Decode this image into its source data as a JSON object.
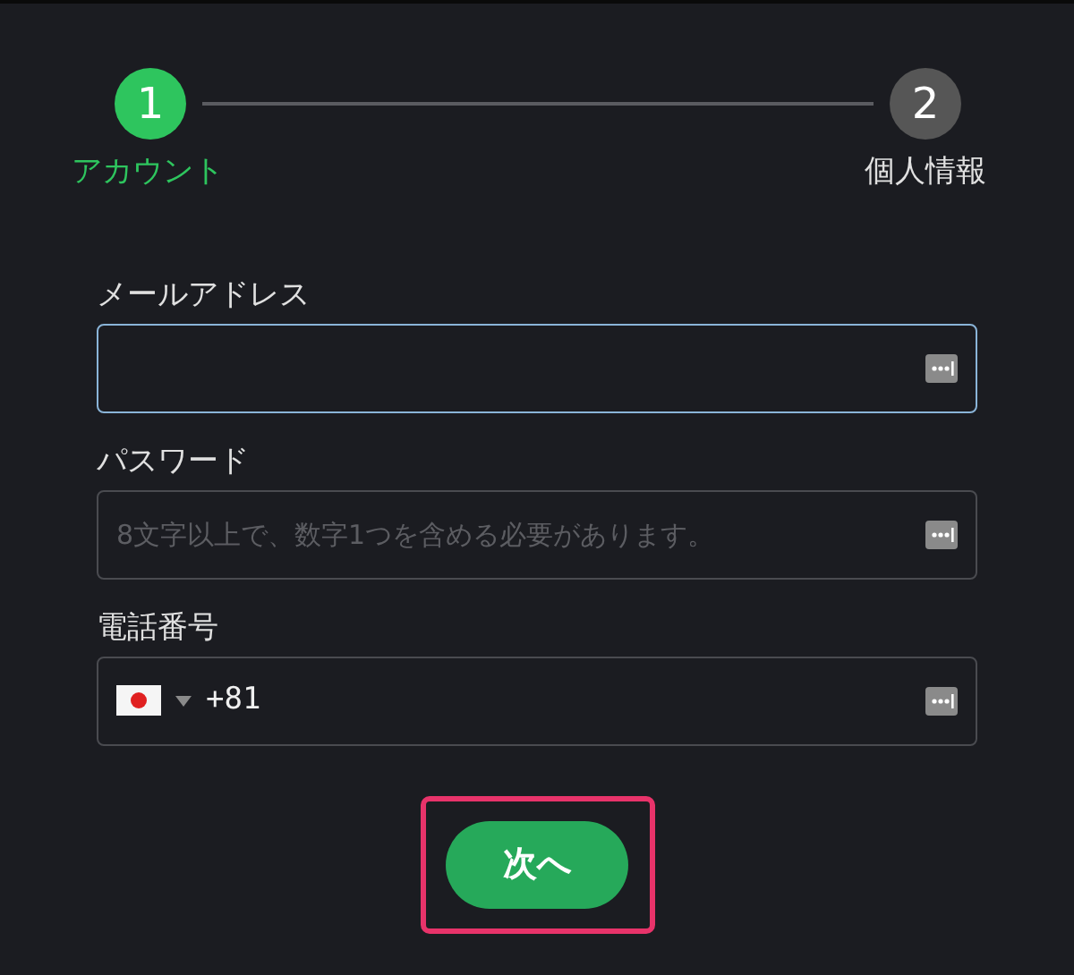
{
  "steps": [
    {
      "number": "1",
      "label": "アカウント",
      "selected": true
    },
    {
      "number": "2",
      "label": "個人情報",
      "selected": false
    }
  ],
  "fields": [
    {
      "kind": "text",
      "label": "メールアドレス",
      "focused": true
    },
    {
      "kind": "text",
      "label": "パスワード",
      "placeholder": "8文字以上で、数字1つを含める必要があります。",
      "focused": false
    },
    {
      "kind": "phone",
      "label": "電話番号",
      "value": "+81",
      "focused": false
    }
  ],
  "next_button": {
    "label": "次へ",
    "highlighted": true
  }
}
